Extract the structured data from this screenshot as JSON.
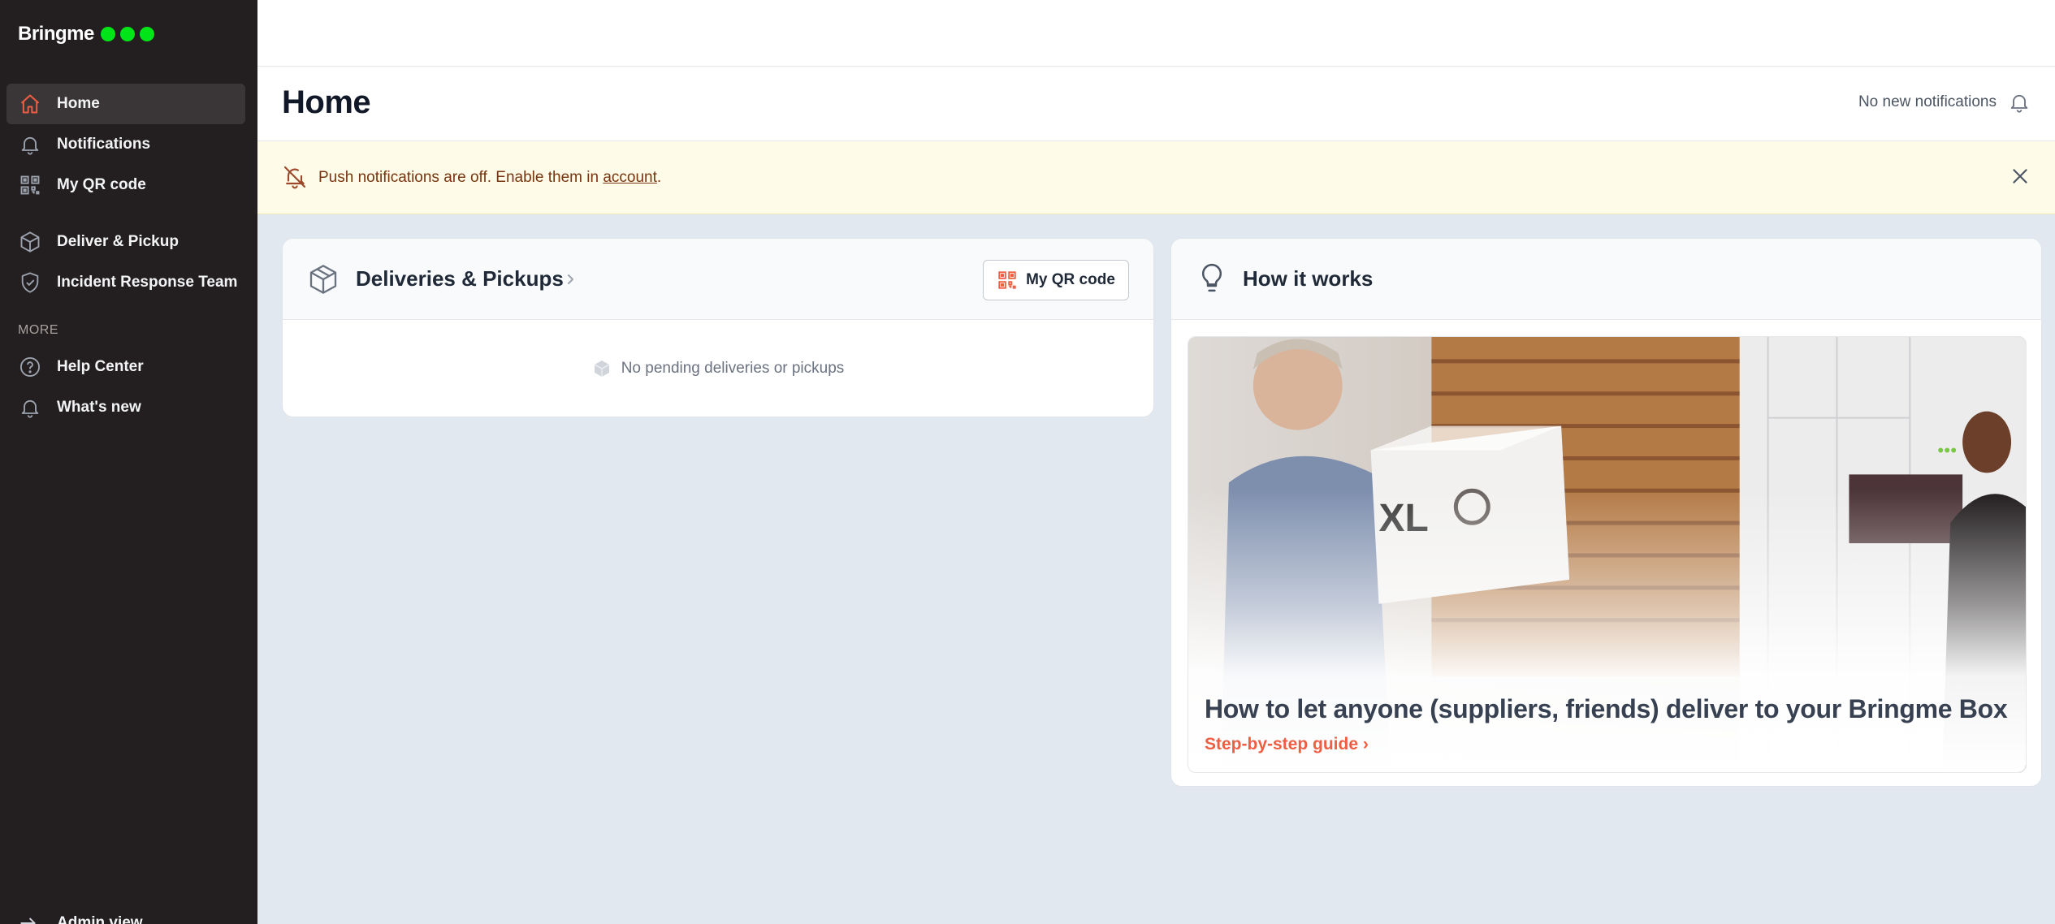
{
  "brand": {
    "name": "Bringme",
    "dot_color": "#00e418"
  },
  "sidebar": {
    "items": [
      {
        "label": "Home",
        "icon": "home-icon",
        "active": true
      },
      {
        "label": "Notifications",
        "icon": "bell-icon"
      },
      {
        "label": "My QR code",
        "icon": "qr-code-icon"
      },
      {
        "label": "Deliver & Pickup",
        "icon": "box-icon"
      },
      {
        "label": "Incident Response Team",
        "icon": "shield-icon"
      }
    ],
    "more_label": "MORE",
    "more_items": [
      {
        "label": "Help Center",
        "icon": "help-icon"
      },
      {
        "label": "What's new",
        "icon": "bell-icon"
      }
    ],
    "admin_label": "Admin view"
  },
  "header": {
    "title": "Home",
    "notification_status": "No new notifications"
  },
  "banner": {
    "text_before": "Push notifications are off. Enable them in ",
    "link": "account",
    "text_after": "."
  },
  "deliveries": {
    "title": "Deliveries & Pickups",
    "qr_button": "My QR code",
    "empty_text": "No pending deliveries or pickups"
  },
  "how_it_works": {
    "title": "How it works",
    "guide_title": "How to let anyone (suppliers, friends) deliver to your Bringme Box",
    "guide_link": "Step-by-step guide ›"
  },
  "colors": {
    "accent": "#ef5e43",
    "sidebar_bg": "#231f20",
    "banner_bg": "#fefbe8"
  }
}
